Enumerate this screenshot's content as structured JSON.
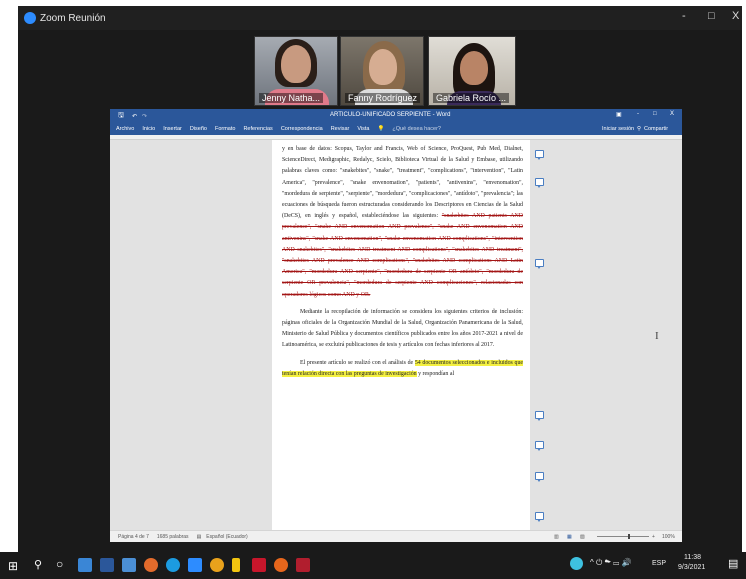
{
  "zoom": {
    "title": "Zoom Reunión",
    "controls": [
      "-",
      "□",
      "X"
    ]
  },
  "participants": [
    {
      "name": "Jenny Natha..."
    },
    {
      "name": "Fanny Rodríguez"
    },
    {
      "name": "Gabriela Rocío ..."
    }
  ],
  "word": {
    "title": "ARTICULO-UNIFICADO SERPIENTE - Word",
    "ribbon_tabs": [
      "Archivo",
      "Inicio",
      "Insertar",
      "Diseño",
      "Formato",
      "Referencias",
      "Correspondencia",
      "Revisar",
      "Vista"
    ],
    "tell_me": "¿Qué desea hacer?",
    "signin": "Iniciar sesión",
    "share": "Compartir",
    "window_controls": [
      "-",
      "□",
      "X"
    ],
    "para1_intro": "y en base de datos: Scopus, Taylor and Francis, Web of Science, ProQuest, Pub Med, Dialnet, ScienceDirect, Medigraphic, Redalyc, Scielo, Biblioteca Virtual de la Salud y Embase, utilizando palabras claves como: \"snakebites\", \"snake\", \"treatment\", \"complications\", \"intervention\", \"Latin America\", \"prevalence\", \"snake envenomation\", \"patients\", \"antivenins\", \"envenomation\", \"mordedura de serpiente\", \"serpiente\", \"mordedura\", \"complicaciones\", \"antídoto\", \"prevalencia\"; las ecuaciones de búsqueda fueron estructuradas considerando los Descriptores en Ciencias de la Salud (DeCS), en inglés y español, estableciéndose las siguientes: ",
    "para1_struck": "\"snakebites AND patients AND prevalence\", \"snake AND envenomation AND prevalence\", \"snake AND envenomation AND antivenins\", \"snake AND envenomation\", \"snake envenomation AND complications\", \"intervention AND snakebites\", \"snakebites AND treatment AND complications\", \"snakebites AND treatment\", \"snakebites AND prevalence AND complications\", \"snakebites AND complications AND Latin America\", \"mordedura AND serpiente\", \"mordedura de serpiente OR antídoto\", \"mordedura de serpiente OR prevalencia\", \"mordedura de serpiente AND complicaciones\", relacionadas con operadores lógicos como AND y OR.",
    "para2": "Mediante la recopilación de información se considera los siguientes criterios de inclusión: páginas oficiales de la Organización Mundial de la Salud, Organización Panamericana de la Salud, Ministerio de Salud Pública y documentos científicos publicados entre los años 2017-2021 a nivel de Latinoamérica, se excluirá publicaciones de tesis y artículos con fechas inferiores al 2017.",
    "para3_plain": "El presente artículo se realizó con el análisis de ",
    "para3_hl": "54 documentos seleccionados e incluidos que tenían relación directa con las preguntas de investigación",
    "para3_tail": " y respondían al",
    "status_left": "Página 4 de 7",
    "status_words": "1685 palabras",
    "status_lang": "Español (Ecuador)",
    "zoom_level": "100%"
  },
  "taskbar": {
    "lang": "ESP",
    "time": "11:38",
    "date": "9/3/2021"
  }
}
